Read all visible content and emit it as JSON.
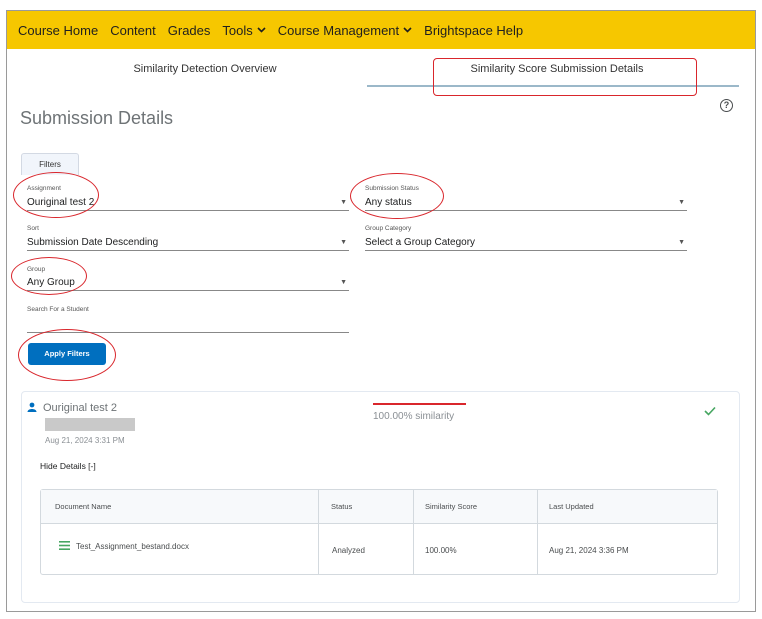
{
  "navbar": {
    "items": [
      {
        "label": "Course Home"
      },
      {
        "label": "Content"
      },
      {
        "label": "Grades"
      },
      {
        "label": "Tools"
      },
      {
        "label": "Course Management"
      },
      {
        "label": "Brightspace Help"
      }
    ],
    "background": "#f6c700"
  },
  "tabs": [
    {
      "label": "Similarity Detection Overview",
      "selected": false
    },
    {
      "label": "Similarity Score Submission Details",
      "selected": true
    }
  ],
  "page_title": "Submission Details",
  "filters": {
    "toggle_label": "Filters",
    "assignment": {
      "label": "Assignment",
      "value": "Ouriginal test 2"
    },
    "submission_status": {
      "label": "Submission Status",
      "value": "Any status"
    },
    "sort": {
      "label": "Sort",
      "value": "Submission Date Descending"
    },
    "group_category": {
      "label": "Group Category",
      "value": "Select a Group Category"
    },
    "group": {
      "label": "Group",
      "value": "Any Group"
    },
    "search": {
      "label": "Search For a Student",
      "value": ""
    },
    "apply_label": "Apply Filters"
  },
  "submission": {
    "student_name": "Ouriginal test 2",
    "date": "Aug 21, 2024 3:31 PM",
    "similarity": "100.00% similarity",
    "hide_details": "Hide Details [-]",
    "table": {
      "headers": [
        "Document Name",
        "Status",
        "Similarity Score",
        "Last Updated"
      ],
      "rows": [
        {
          "document": "Test_Assignment_bestand.docx",
          "status": "Analyzed",
          "score": "100.00%",
          "updated": "Aug 21, 2024 3:36 PM"
        }
      ]
    }
  },
  "colors": {
    "accent_blue": "#006fbf",
    "annotation_red": "#d9262c",
    "success_green": "#46a661"
  }
}
